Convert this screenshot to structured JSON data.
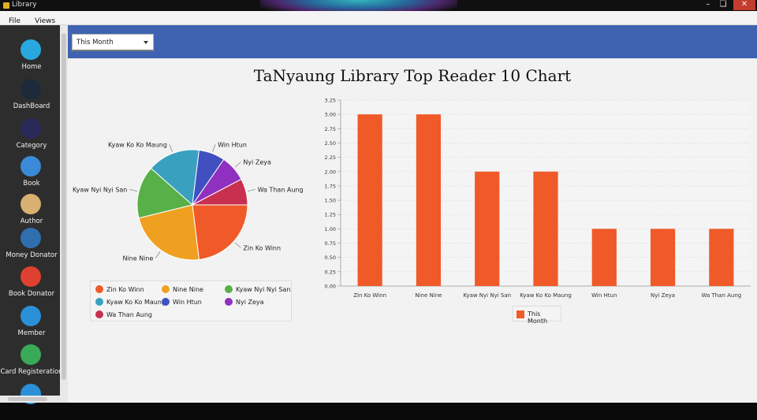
{
  "window": {
    "title": "Library"
  },
  "menu": [
    "File",
    "Views"
  ],
  "sidebar": {
    "items": [
      {
        "label": "Home",
        "icon": "home-icon",
        "color": "#29a8e0"
      },
      {
        "label": "DashBoard",
        "icon": "dashboard-icon",
        "color": "#1c2a3a"
      },
      {
        "label": "Category",
        "icon": "category-icon",
        "color": "#2a2a5a"
      },
      {
        "label": "Book",
        "icon": "book-icon",
        "color": "#3a8ad8"
      },
      {
        "label": "Author",
        "icon": "author-icon",
        "color": "#d8b070"
      },
      {
        "label": "Money Donator",
        "icon": "money-donator-icon",
        "color": "#2f6fb0"
      },
      {
        "label": "Book Donator",
        "icon": "book-donator-icon",
        "color": "#e04030"
      },
      {
        "label": "Member",
        "icon": "member-icon",
        "color": "#2a90d8"
      },
      {
        "label": "Card Registeration",
        "icon": "card-registration-icon",
        "color": "#3aaa58"
      },
      {
        "label": "",
        "icon": "report-icon",
        "color": "#2a90d8"
      }
    ]
  },
  "filter": {
    "selected": "This Month"
  },
  "chart_title": "TaNyaung Library Top Reader 10 Chart",
  "chart_data": [
    {
      "type": "pie",
      "categories": [
        "Zin Ko Winn",
        "Nine Nine",
        "Kyaw Nyi Nyi San",
        "Kyaw Ko Ko Maung",
        "Win Htun",
        "Nyi Zeya",
        "Wa Than Aung"
      ],
      "values": [
        3,
        3,
        2,
        2,
        1,
        1,
        1
      ],
      "colors": [
        "#f05a28",
        "#f0a020",
        "#58b048",
        "#3aa0c0",
        "#4050c0",
        "#9030c0",
        "#c83050"
      ],
      "legend": "bottom"
    },
    {
      "type": "bar",
      "categories": [
        "Zin Ko Winn",
        "Nine Nine",
        "Kyaw Nyi Nyi San",
        "Kyaw Ko Ko Maung",
        "Win Htun",
        "Nyi Zeya",
        "Wa Than Aung"
      ],
      "series": [
        {
          "name": "This Month",
          "values": [
            3,
            3,
            2,
            2,
            1,
            1,
            1
          ]
        }
      ],
      "ylim": [
        0,
        3.25
      ],
      "yticks": [
        "0.00",
        "0.25",
        "0.50",
        "0.75",
        "1.00",
        "1.25",
        "1.50",
        "1.75",
        "2.00",
        "2.25",
        "2.50",
        "2.75",
        "3.00",
        "3.25"
      ],
      "color": "#f05a28",
      "grid": true,
      "legend": "bottom"
    }
  ]
}
